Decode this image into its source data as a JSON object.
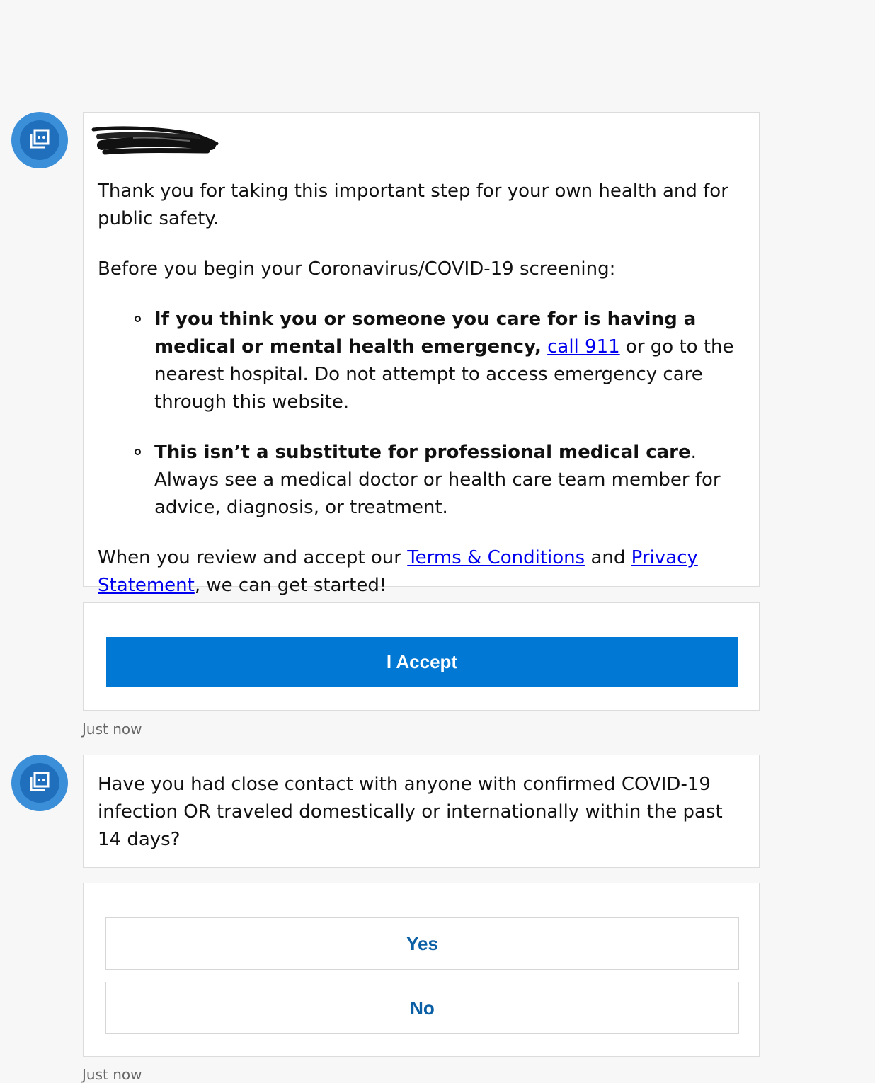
{
  "message1": {
    "intro": "Thank you for taking this important step for your own health and for public safety.",
    "before_begin": "Before you begin your Coronavirus/COVID-19 screening:",
    "bullet1": {
      "bold": "If you think you or someone you care for is having a medical or mental health emergency,",
      "link": "call 911",
      "rest1": " or go to the nearest hospital. Do not attempt to access emergency care through this website."
    },
    "bullet2": {
      "bold": "This isn’t a substitute for professional medical care",
      "rest": ". Always see a medical doctor or health care team member for advice, diagnosis, or treatment."
    },
    "closing": {
      "pre": "When you review and accept our ",
      "terms_link": "Terms & Conditions",
      "mid": " and ",
      "privacy_link": "Privacy Statement",
      "post": ", we can get started!"
    }
  },
  "accept_card": {
    "button_label": "I Accept"
  },
  "timestamp1": "Just now",
  "message2": {
    "text": "Have you had close contact with anyone with confirmed COVID-19 infection OR traveled domestically or internationally within the past 14 days?"
  },
  "choices": {
    "yes_label": "Yes",
    "no_label": "No"
  },
  "timestamp2": "Just now",
  "colors": {
    "primary_button": "#0078d4",
    "choice_text": "#0b5fa5",
    "link": "#0000ee",
    "avatar_outer": "#3b8fd9",
    "avatar_inner": "#1f6fbd"
  },
  "icons": {
    "avatar": "bot-icon",
    "redaction": "redacted-scribble"
  }
}
